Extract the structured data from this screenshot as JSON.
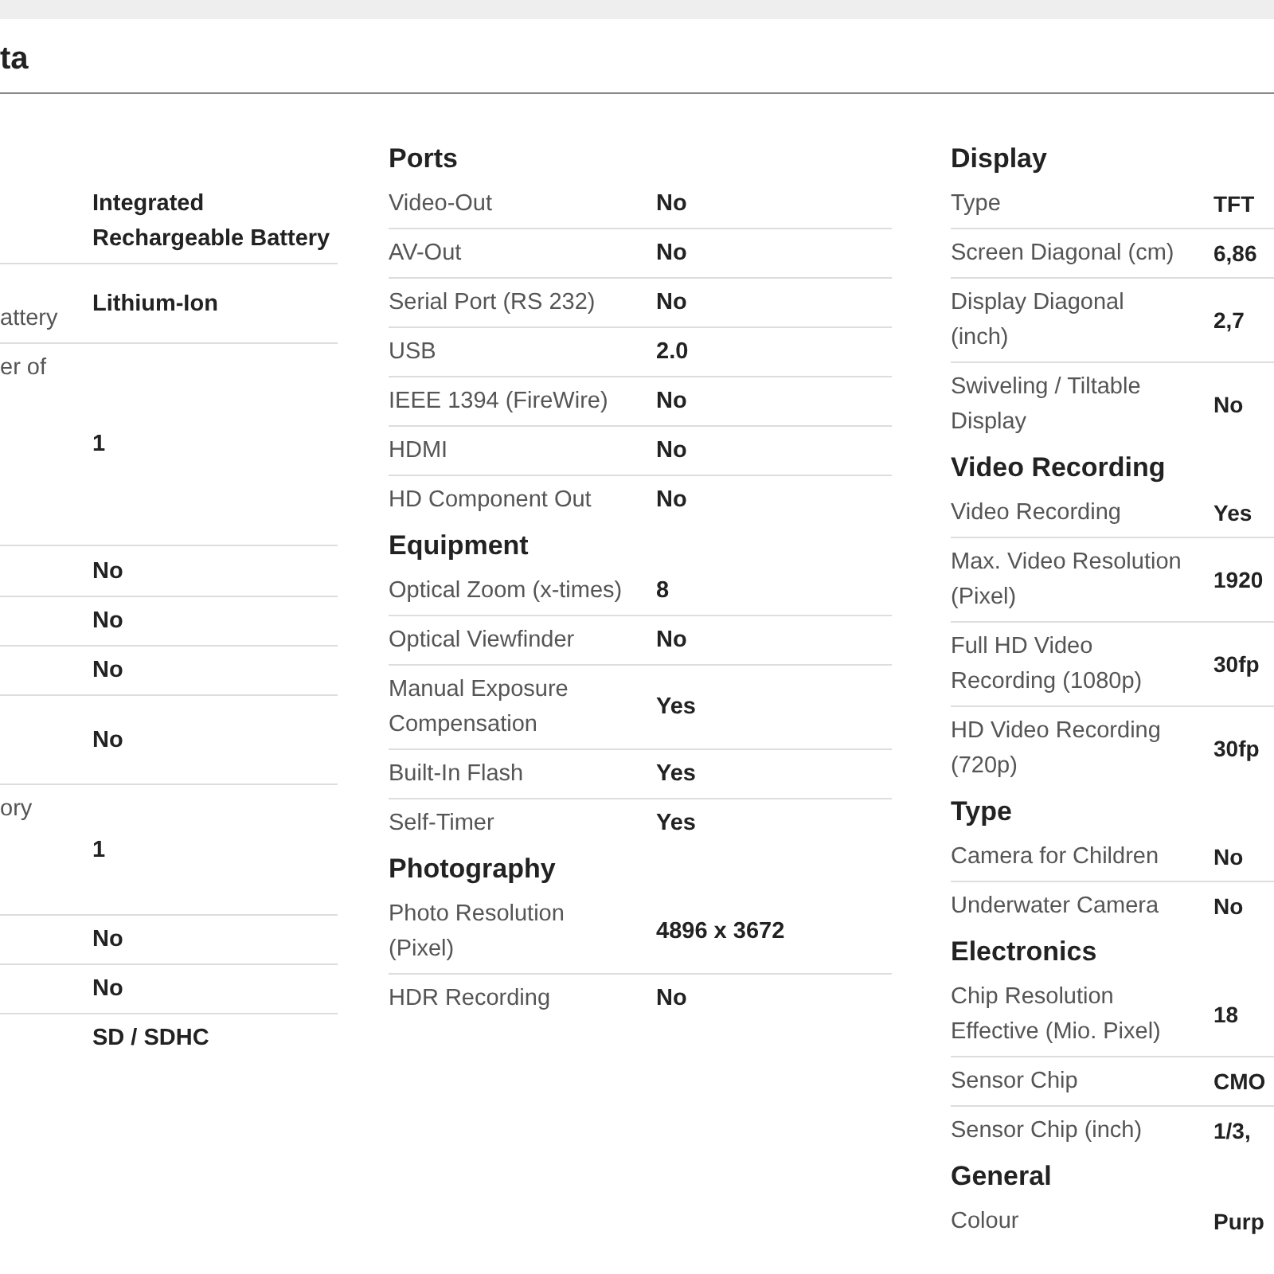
{
  "header": {
    "title": "ta"
  },
  "columns": [
    {
      "sections": [
        {
          "rows": [
            {
              "value": "Integrated Rechargeable Battery"
            },
            {
              "label": "attery",
              "value": "Lithium-Ion"
            },
            {
              "label": "er of",
              "value": "1"
            },
            {
              "value": "No"
            },
            {
              "value": "No"
            },
            {
              "value": "No"
            },
            {
              "value": "No"
            },
            {
              "label": "ory",
              "value": "1"
            },
            {
              "value": "No"
            },
            {
              "value": "No"
            },
            {
              "value": "SD / SDHC"
            }
          ]
        }
      ]
    },
    {
      "sections": [
        {
          "heading": "Ports",
          "rows": [
            {
              "label": "Video-Out",
              "value": "No"
            },
            {
              "label": "AV-Out",
              "value": "No"
            },
            {
              "label": "Serial Port (RS 232)",
              "value": "No"
            },
            {
              "label": "USB",
              "value": "2.0"
            },
            {
              "label": "IEEE 1394 (FireWire)",
              "value": "No"
            },
            {
              "label": "HDMI",
              "value": "No"
            },
            {
              "label": "HD Component Out",
              "value": "No"
            }
          ]
        },
        {
          "heading": "Equipment",
          "rows": [
            {
              "label": "Optical Zoom (x-times)",
              "value": "8"
            },
            {
              "label": "Optical Viewfinder",
              "value": "No"
            },
            {
              "label": "Manual Exposure Compensation",
              "value": "Yes"
            },
            {
              "label": "Built-In Flash",
              "value": "Yes"
            },
            {
              "label": "Self-Timer",
              "value": "Yes"
            }
          ]
        },
        {
          "heading": "Photography",
          "rows": [
            {
              "label": "Photo Resolution (Pixel)",
              "value": "4896 x 3672"
            },
            {
              "label": "HDR Recording",
              "value": "No"
            }
          ]
        }
      ]
    },
    {
      "sections": [
        {
          "heading": "Display",
          "rows": [
            {
              "label": "Type",
              "value": "TFT"
            },
            {
              "label": "Screen Diagonal (cm)",
              "value": "6,86"
            },
            {
              "label": "Display Diagonal (inch)",
              "value": "2,7"
            },
            {
              "label": "Swiveling / Tiltable Display",
              "value": "No"
            }
          ]
        },
        {
          "heading": "Video Recording",
          "rows": [
            {
              "label": "Video Recording",
              "value": "Yes"
            },
            {
              "label": "Max. Video Resolution (Pixel)",
              "value": "1920"
            },
            {
              "label": "Full HD Video Recording (1080p)",
              "value": "30fp"
            },
            {
              "label": "HD Video Recording (720p)",
              "value": "30fp"
            }
          ]
        },
        {
          "heading": "Type",
          "rows": [
            {
              "label": "Camera for Children",
              "value": "No"
            },
            {
              "label": "Underwater Camera",
              "value": "No"
            }
          ]
        },
        {
          "heading": "Electronics",
          "rows": [
            {
              "label": "Chip Resolution Effective (Mio. Pixel)",
              "value": "18"
            },
            {
              "label": "Sensor Chip",
              "value": "CMO"
            },
            {
              "label": "Sensor Chip (inch)",
              "value": "1/3,"
            }
          ]
        },
        {
          "heading": "General",
          "rows": [
            {
              "label": "Colour",
              "value": "Purp"
            }
          ]
        }
      ]
    }
  ]
}
